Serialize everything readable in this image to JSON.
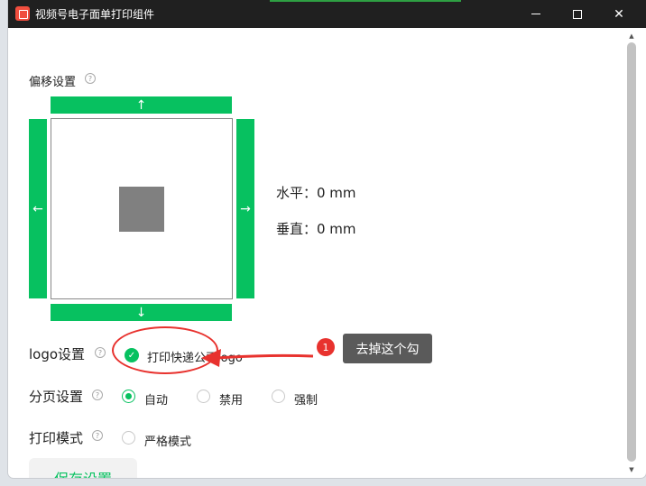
{
  "window": {
    "title": "视频号电子面单打印组件",
    "accent_color": "#07c160"
  },
  "offset": {
    "label": "偏移设置",
    "help": "?",
    "arrows": {
      "up": "↑",
      "down": "↓",
      "left": "←",
      "right": "→"
    },
    "horizontal": "水平：0 mm",
    "vertical": "垂直：0 mm"
  },
  "logo": {
    "label": "logo设置",
    "help": "?",
    "checkbox_label": "打印快递公司logo",
    "checked": true
  },
  "paging": {
    "label": "分页设置",
    "help": "?",
    "options": [
      "自动",
      "禁用",
      "强制"
    ],
    "selected": "自动"
  },
  "print_mode": {
    "label": "打印模式",
    "help": "?",
    "option": "严格模式",
    "checked": false
  },
  "save": {
    "label": "保存设置"
  },
  "annotation": {
    "badge": "1",
    "text": "去掉这个勾",
    "color": "#e8322e"
  }
}
